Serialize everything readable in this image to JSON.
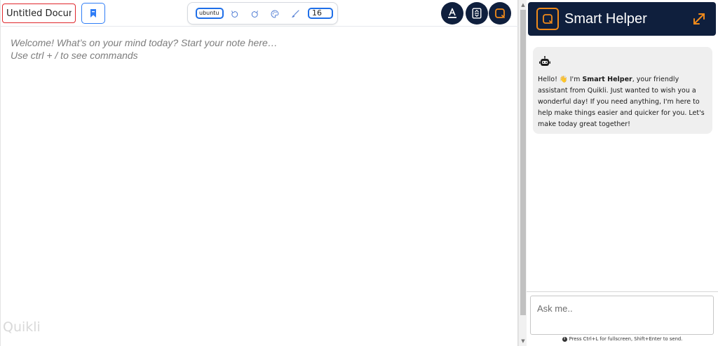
{
  "document": {
    "title_value": "Untitled Document",
    "editor_placeholder_line1": "Welcome! What’s on your mind today? Start your note here…",
    "editor_placeholder_line2": "Use ctrl + / to see commands",
    "watermark": "Quikli"
  },
  "toolbar": {
    "font_family_value": "ubuntu",
    "font_size_value": "16",
    "icons": [
      "undo-icon",
      "redo-icon",
      "palette-icon",
      "brush-icon"
    ]
  },
  "topbar_buttons": [
    "text-color-icon",
    "fit-height-icon",
    "quikli-logo-icon"
  ],
  "helper": {
    "title": "Smart Helper",
    "greeting_before": "Hello! 👋 I'm ",
    "greeting_name": "Smart Helper",
    "greeting_after": ", your friendly assistant from Quikli. Just wanted to wish you a wonderful day! If you need anything, I'm here to help make things easier and quicker for you. Let's make today great together!",
    "input_placeholder": "Ask me..",
    "hint": "Press Ctrl+L for fullscreen, Shift+Enter to send."
  },
  "colors": {
    "navy": "#0f1f3d",
    "accent_orange": "#f08a1a",
    "accent_blue": "#1f6fe8",
    "title_border_red": "#e0272c"
  }
}
